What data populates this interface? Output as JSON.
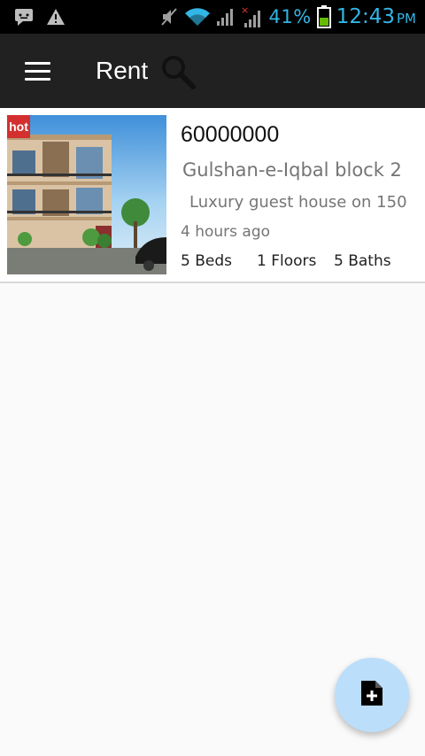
{
  "status_bar": {
    "battery_percent": "41%",
    "time": "12:43",
    "ampm": "PM",
    "icons": [
      "message-icon",
      "warning-icon",
      "mute-icon",
      "wifi-icon",
      "signal-icon",
      "signal-no-data-icon",
      "battery-icon"
    ]
  },
  "app_bar": {
    "title": "Rent",
    "menu_icon": "hamburger-icon",
    "search_icon": "search-icon"
  },
  "listings": [
    {
      "badge": "hot",
      "price": "60000000",
      "location": "Gulshan-e-Iqbal block 2",
      "description": "Luxury guest house on 150",
      "time_ago": "4 hours ago",
      "beds": "5 Beds",
      "floors": "1 Floors",
      "baths": "5 Baths"
    }
  ],
  "fab": {
    "icon": "add-document-icon"
  },
  "colors": {
    "status_accent": "#33b5e5",
    "app_bar_bg": "#212121",
    "hot_badge": "#d32f2f",
    "fab_bg": "#bbdefb"
  }
}
